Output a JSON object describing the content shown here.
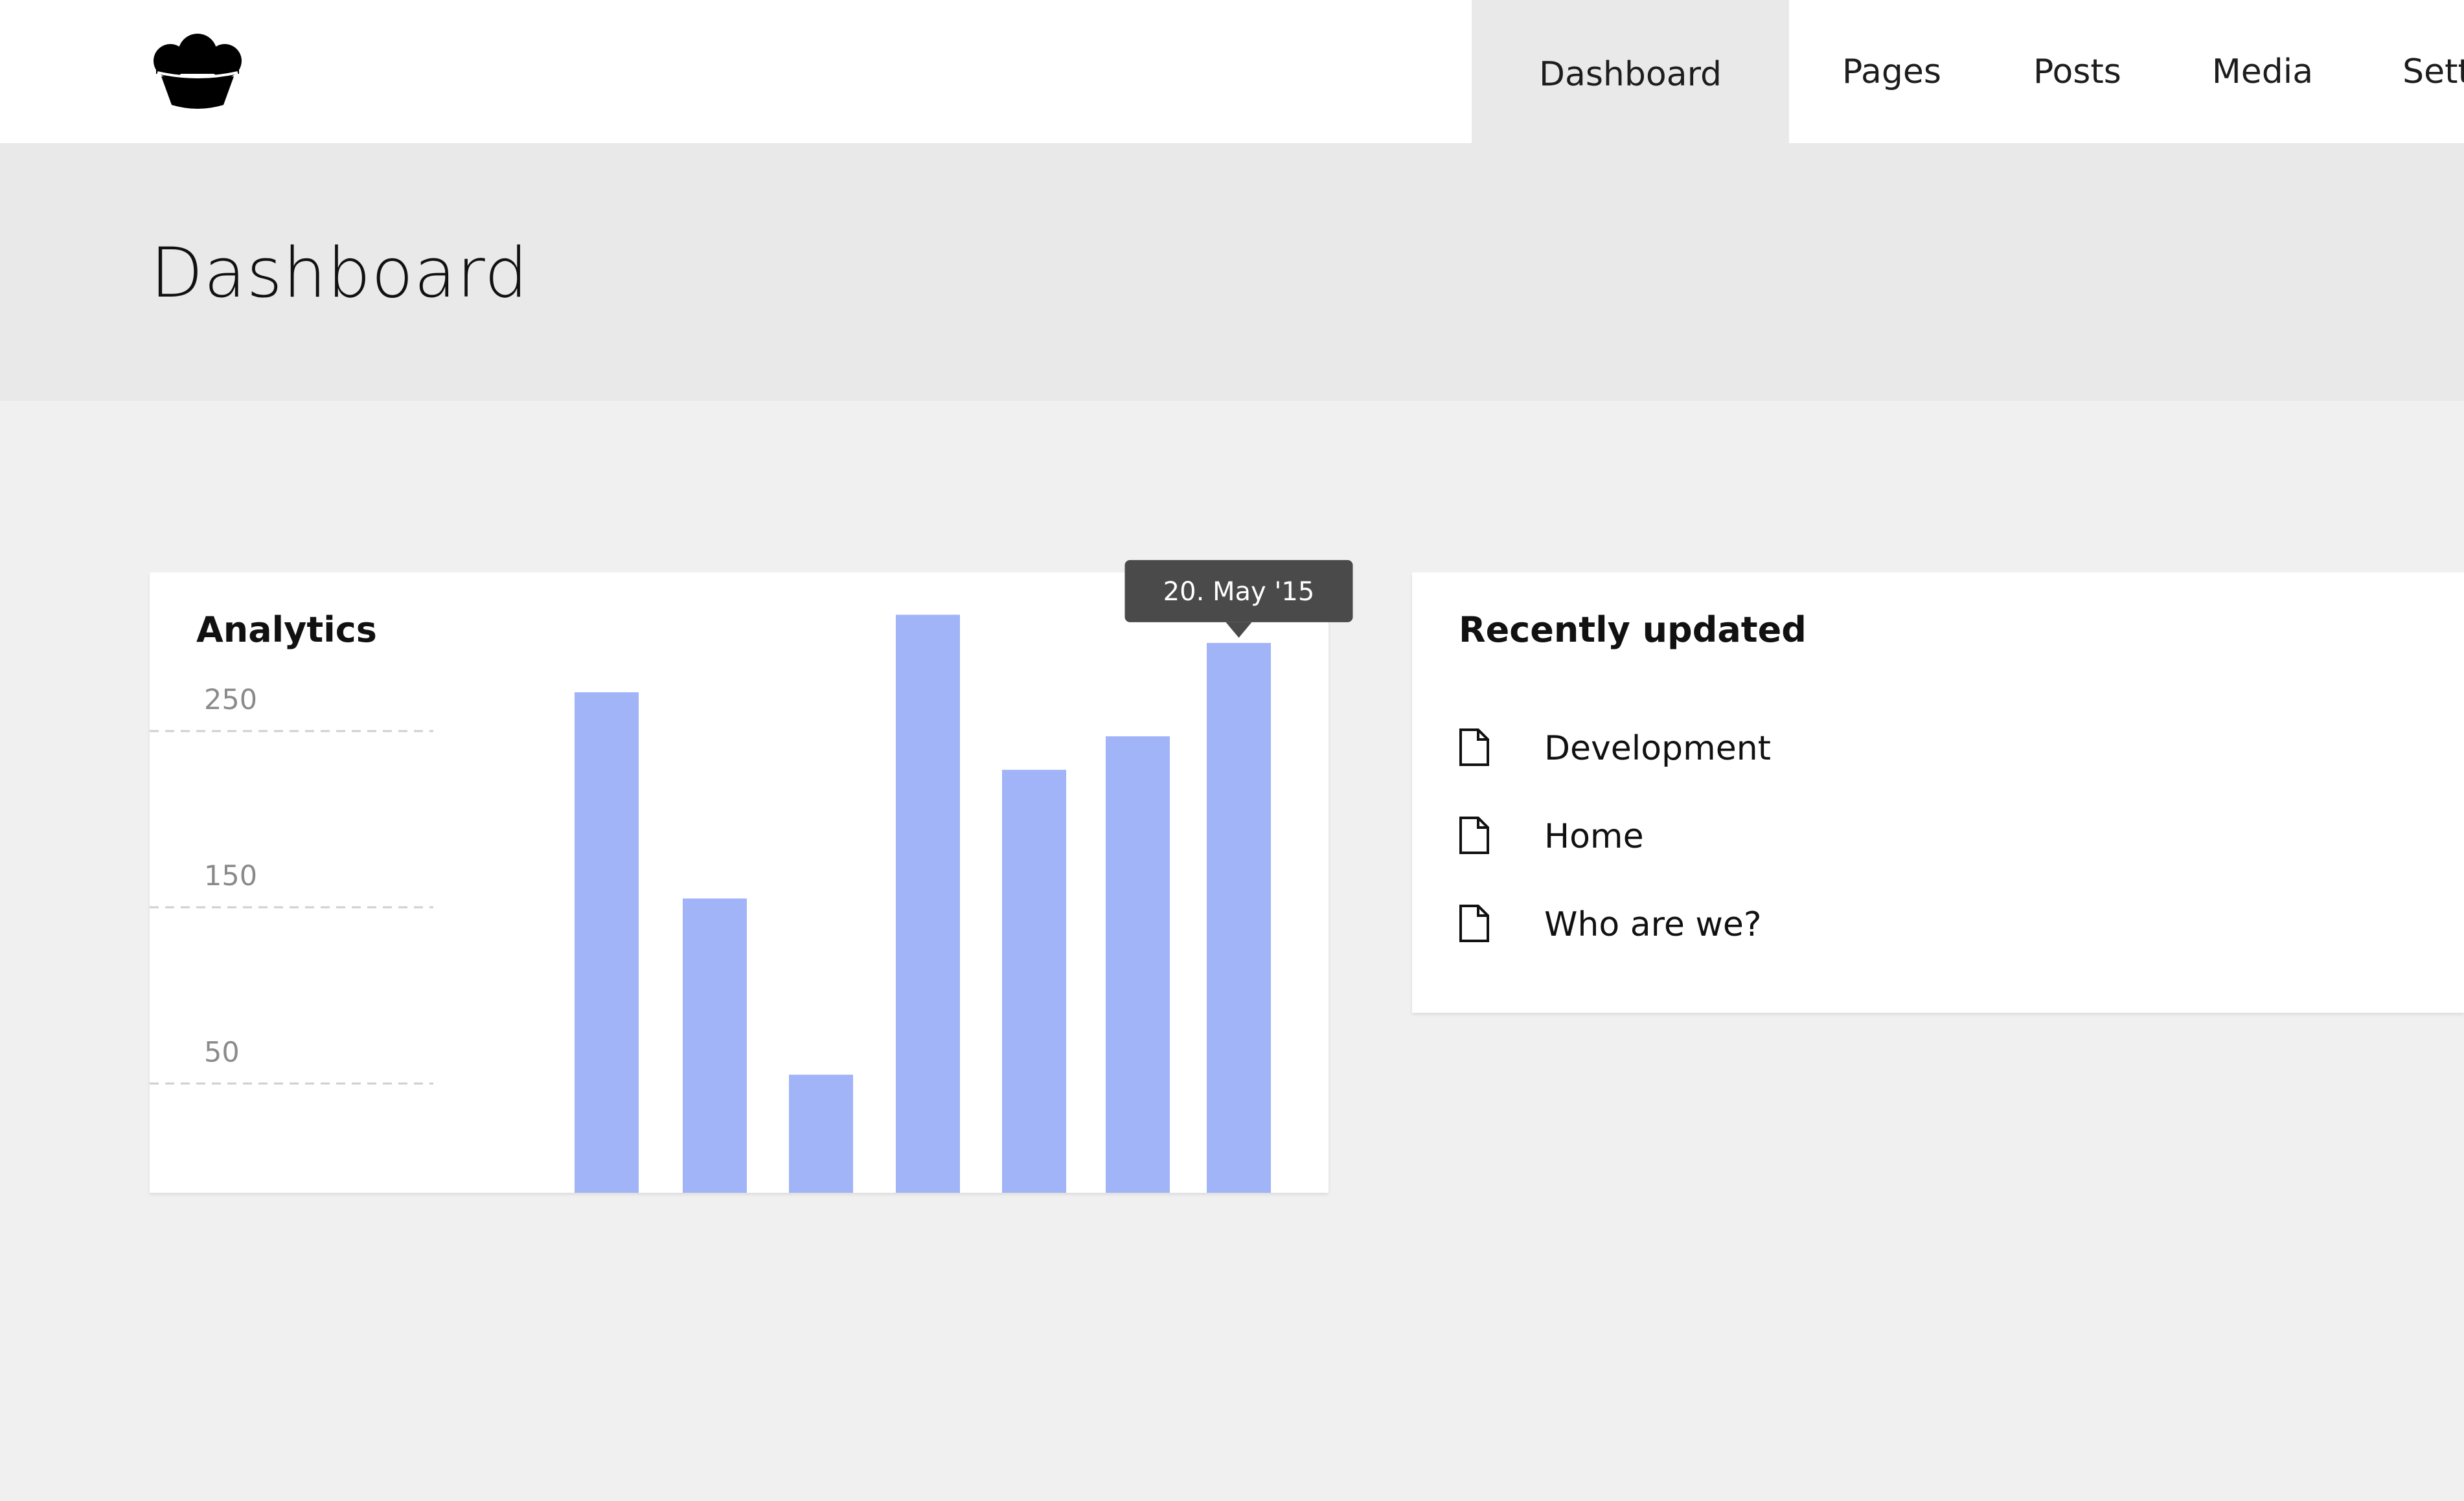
{
  "header": {
    "logo_icon": "cupcake-logo-icon",
    "nav": [
      {
        "label": "Dashboard",
        "active": true
      },
      {
        "label": "Pages",
        "active": false
      },
      {
        "label": "Posts",
        "active": false
      },
      {
        "label": "Media",
        "active": false
      },
      {
        "label": "Setti",
        "active": false
      }
    ]
  },
  "page": {
    "title": "Dashboard"
  },
  "analytics": {
    "title": "Analytics",
    "tooltip": "20. May '15"
  },
  "chart_data": {
    "type": "bar",
    "title": "Analytics",
    "xlabel": "",
    "ylabel": "",
    "y_ticks": [
      50,
      150,
      250
    ],
    "ylim": [
      -12,
      340
    ],
    "grid": "dashed horizontal lines at y ticks",
    "bar_color": "#a0b4f7",
    "values": [
      272,
      155,
      55,
      316,
      228,
      247,
      300
    ],
    "highlighted_index": 6,
    "tooltip_label": "20. May '15"
  },
  "recent": {
    "title": "Recently updated",
    "items": [
      {
        "label": "Development",
        "icon": "document-icon"
      },
      {
        "label": "Home",
        "icon": "document-icon"
      },
      {
        "label": "Who are we?",
        "icon": "document-icon"
      }
    ]
  },
  "colors": {
    "background": "#f0f0f0",
    "header": "#ffffff",
    "title_band": "#e9e9e9",
    "active_tab": "#e9e9e9",
    "bar": "#a0b4f7",
    "tooltip": "#4a4a4a"
  }
}
